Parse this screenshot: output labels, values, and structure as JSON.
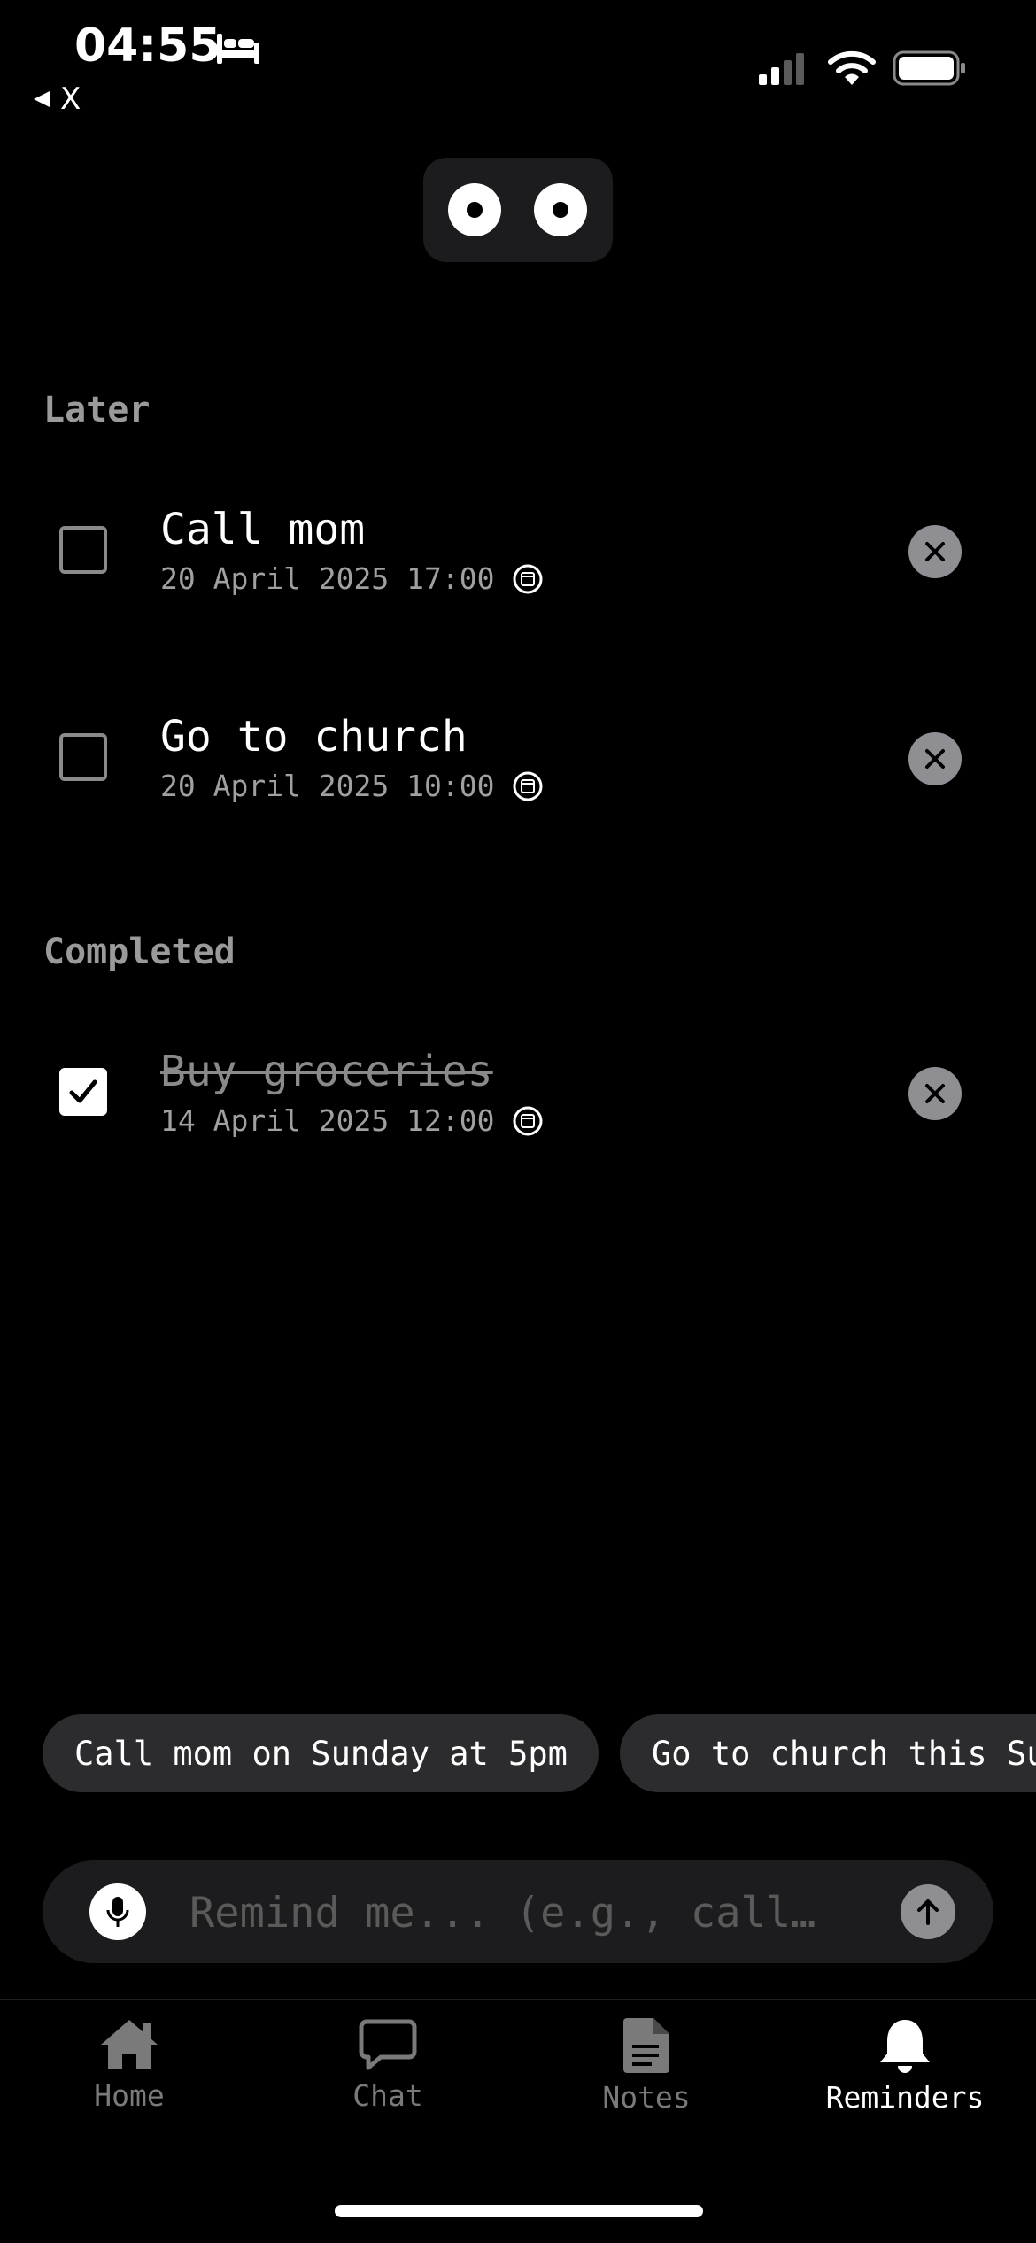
{
  "status_bar": {
    "time": "04:55",
    "back_label": "X"
  },
  "sections": {
    "later": {
      "label": "Later",
      "items": [
        {
          "title": "Call mom",
          "date": "20 April 2025 17:00",
          "completed": false
        },
        {
          "title": "Go to church",
          "date": "20 April 2025 10:00",
          "completed": false
        }
      ]
    },
    "completed": {
      "label": "Completed",
      "items": [
        {
          "title": "Buy groceries",
          "date": "14 April 2025 12:00",
          "completed": true
        }
      ]
    }
  },
  "suggestions": [
    "Call mom on Sunday at 5pm",
    "Go to church this Su"
  ],
  "input": {
    "placeholder": "Remind me... (e.g., call…",
    "value": ""
  },
  "tabs": [
    {
      "label": "Home",
      "icon": "house-icon",
      "active": false
    },
    {
      "label": "Chat",
      "icon": "chat-bubble-icon",
      "active": false
    },
    {
      "label": "Notes",
      "icon": "document-icon",
      "active": false
    },
    {
      "label": "Reminders",
      "icon": "bell-icon",
      "active": true
    }
  ],
  "colors": {
    "background": "#000000",
    "muted_text": "#9a9a9a",
    "chip_background": "#2c2c2e",
    "delete_button": "#8e8e93"
  }
}
